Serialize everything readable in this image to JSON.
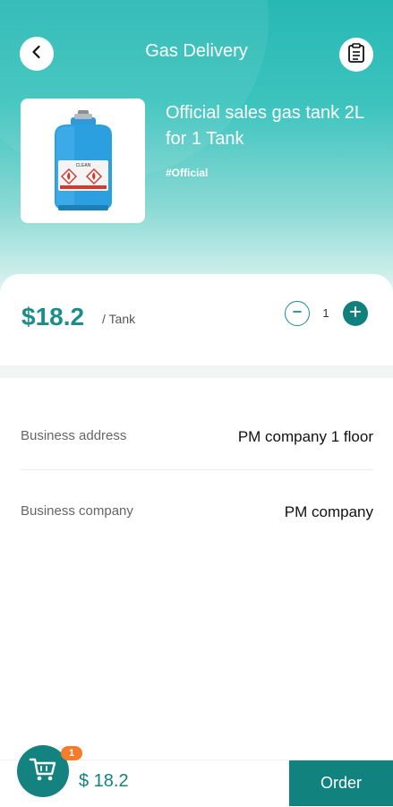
{
  "header": {
    "title": "Gas Delivery",
    "back_icon": "chevron-left-icon",
    "list_icon": "clipboard-list-icon"
  },
  "product": {
    "name": "Official sales gas tank 2L for 1 Tank",
    "tag": "#Official",
    "image": "gas-cylinder-image"
  },
  "pricing": {
    "price": "$18.2",
    "unit": "/ Tank",
    "quantity": "1"
  },
  "details": [
    {
      "label": "Business address",
      "value": "PM company 1 floor"
    },
    {
      "label": "Business company",
      "value": "PM company"
    }
  ],
  "footer": {
    "cart_icon": "shopping-cart-icon",
    "cart_count": "1",
    "total": "$ 18.2",
    "order_label": "Order"
  },
  "colors": {
    "accent": "#14837f",
    "header_gradient_top": "#28b8b4",
    "badge": "#f57c2a"
  }
}
